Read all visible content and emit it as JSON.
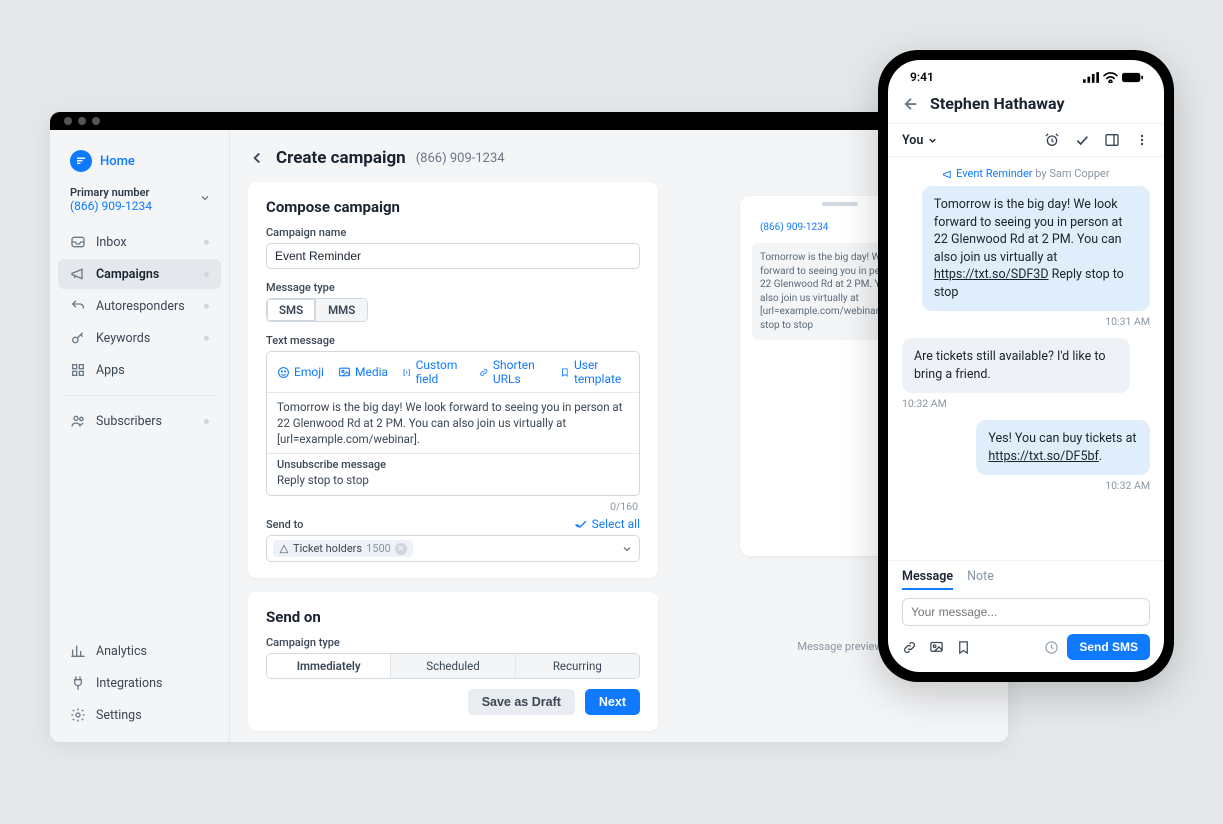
{
  "sidebar": {
    "home": "Home",
    "primary_label": "Primary number",
    "primary_number": "(866) 909-1234",
    "items": [
      {
        "label": "Inbox"
      },
      {
        "label": "Campaigns"
      },
      {
        "label": "Autoresponders"
      },
      {
        "label": "Keywords"
      },
      {
        "label": "Apps"
      }
    ],
    "subscribers": "Subscribers",
    "footer": [
      {
        "label": "Analytics"
      },
      {
        "label": "Integrations"
      },
      {
        "label": "Settings"
      }
    ]
  },
  "header": {
    "title": "Create campaign",
    "phone": "(866) 909-1234"
  },
  "compose": {
    "title": "Compose campaign",
    "name_label": "Campaign name",
    "name_value": "Event Reminder",
    "type_label": "Message type",
    "type_options": [
      "SMS",
      "MMS"
    ],
    "text_label": "Text message",
    "toolbar": {
      "emoji": "Emoji",
      "media": "Media",
      "custom": "Custom field",
      "shorten": "Shorten URLs",
      "template": "User template"
    },
    "message": "Tomorrow is the big day! We look forward to seeing you in person at 22 Glenwood Rd at 2 PM. You can also join us virtually at [url=example.com/webinar].",
    "unsub_label": "Unsubscribe message",
    "unsub_text": "Reply stop to stop",
    "char_count": "0/160",
    "sendto_label": "Send to",
    "select_all": "Select all",
    "chip_name": "Ticket holders",
    "chip_count": "1500"
  },
  "sendon": {
    "title": "Send on",
    "type_label": "Campaign type",
    "options": [
      "Immediately",
      "Scheduled",
      "Recurring"
    ]
  },
  "actions": {
    "draft": "Save as Draft",
    "next": "Next"
  },
  "bg_preview": {
    "number": "(866) 909-1234",
    "text": "Tomorrow is the big day! We look forward to seeing you in person at 22 Glenwood Rd at 2 PM. You can also join us virtually at [url=example.com/webinar]. Reply stop to stop",
    "caption": "Message preview"
  },
  "phone": {
    "time": "9:41",
    "contact": "Stephen Hathaway",
    "you": "You",
    "event_name": "Event Reminder",
    "event_by": "by Sam Copper",
    "msg1_a": "Tomorrow is the big day! We look forward to seeing you in person at 22 Glenwood Rd at 2 PM. You can also join us virtually at ",
    "msg1_link": "https://txt.so/SDF3D",
    "msg1_b": " Reply stop to stop",
    "ts1": "10:31 AM",
    "msg2": "Are tickets still available? I'd like to bring a friend.",
    "ts2": "10:32 AM",
    "msg3_a": "Yes! You can buy tickets at ",
    "msg3_link": "https://txt.so/DF5bf",
    "msg3_b": ".",
    "ts3": "10:32 AM",
    "tabs": {
      "message": "Message",
      "note": "Note"
    },
    "placeholder": "Your message...",
    "send": "Send SMS"
  }
}
